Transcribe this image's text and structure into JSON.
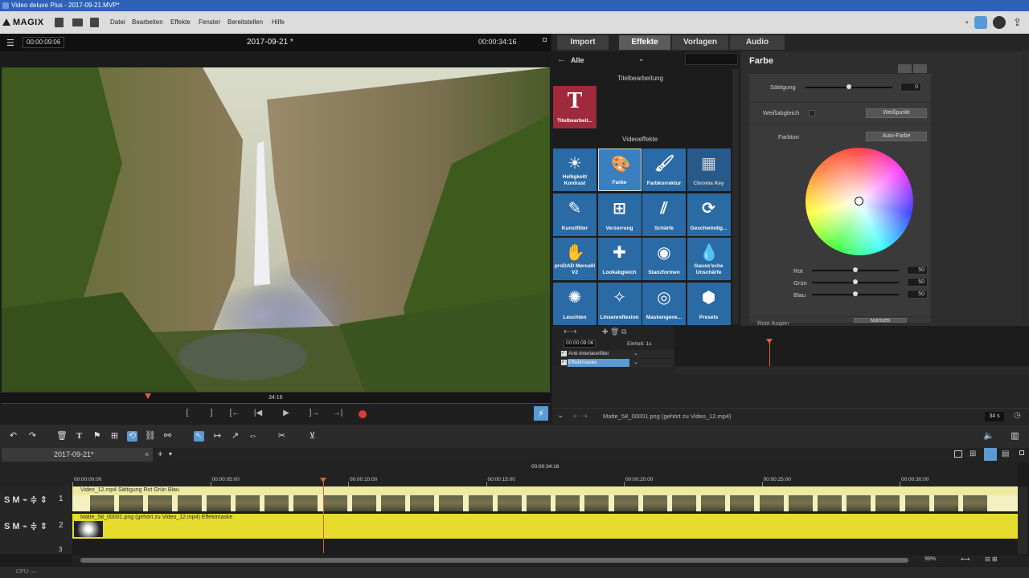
{
  "window": {
    "title": "Video deluxe Plus - 2017-09-21.MVP*"
  },
  "menu": {
    "logo": "MAGIX",
    "items": [
      "Datei",
      "Bearbeiten",
      "Effekte",
      "Fenster",
      "Bereitstellen",
      "Hilfe"
    ]
  },
  "preview": {
    "timecode_left": "00:00:09:06",
    "title": "2017-09-21 *",
    "timecode_right": "00:00:34:16",
    "scrub_label": "34:16",
    "controls": [
      "[",
      "]",
      "[←",
      "|◀",
      "▶",
      "]→",
      "→|"
    ]
  },
  "tabs": [
    "Import",
    "Effekte",
    "Vorlagen",
    "Audio"
  ],
  "fx": {
    "category": "Alle",
    "section1": "Titelbearbeitung",
    "title_tile": "Titelbearbeit...",
    "section2": "Videoeffekte",
    "tiles": [
      {
        "label": "Helligkeit/ Kontrast",
        "icon": "sun-icon"
      },
      {
        "label": "Farbe",
        "icon": "palette-icon"
      },
      {
        "label": "Farbkorrektur",
        "icon": "palette-brush-icon"
      },
      {
        "label": "Chroma Key",
        "icon": "chroma-key-icon"
      },
      {
        "label": "Kunstfilter",
        "icon": "art-filter-icon"
      },
      {
        "label": "Verzerrung",
        "icon": "grid-distort-icon"
      },
      {
        "label": "Schärfe",
        "icon": "sharpness-icon"
      },
      {
        "label": "Geschwindig...",
        "icon": "speed-icon"
      },
      {
        "label": "proDAD Mercalli V2",
        "icon": "hand-icon"
      },
      {
        "label": "Lookabgleich",
        "icon": "look-match-icon"
      },
      {
        "label": "Stanzformen",
        "icon": "stencil-icon"
      },
      {
        "label": "Gauss'sche Unschärfe",
        "icon": "blur-drop-icon"
      },
      {
        "label": "Leuchten",
        "icon": "glow-icon"
      },
      {
        "label": "Linsenreflexion",
        "icon": "lens-flare-icon"
      },
      {
        "label": "Maskengene...",
        "icon": "mask-icon"
      },
      {
        "label": "Presets",
        "icon": "hexagon-icon"
      }
    ]
  },
  "farbe": {
    "title": "Farbe",
    "saettigung_label": "Sättigung",
    "saettigung_value": "0",
    "saettigung_level": 0.5,
    "weissabgleich_label": "Weißabgleich",
    "weisspunkt_btn": "Weißpunkt",
    "farbton_label": "Farbton",
    "autofarbe_btn": "Auto-Farbe",
    "rgb": [
      {
        "label": "Rot",
        "value": "50",
        "level": 0.5
      },
      {
        "label": "Grün",
        "value": "50",
        "level": 0.5
      },
      {
        "label": "Blau",
        "value": "50",
        "level": 0.5
      }
    ],
    "rote_augen_label": "Rote Augen",
    "manuell_btn": "Manuell"
  },
  "keyframe": {
    "timecode": "00:00:09:06",
    "einheit": "Einheit: 1s",
    "rows": [
      "Anti-Interlacefilter",
      "Effektmaske"
    ]
  },
  "info_bar": {
    "text": "Matte_58_00001.png (gehört zu Video_12.mp4)",
    "duration": "34 s"
  },
  "timeline": {
    "tab": "2017-09-21*",
    "ruler_top": "00:00:34:16",
    "ticks": [
      "00:00:00:00",
      "00:00:05:00",
      "00:00:10:00",
      "00:00:15:00",
      "00:00:20:00",
      "00:00:25:00",
      "00:00:30:00"
    ],
    "track1_label": "Video_12.mp4  Sättigung  Rot  Grün  Blau",
    "track2_label": "Matte_58_00001.png (gehört zu Video_12.mp4) Effektmaske",
    "track_numbers": [
      "1",
      "2",
      "3"
    ],
    "zoom": "99%"
  },
  "status": {
    "cpu": "CPU: —"
  },
  "colors": {
    "accent": "#2a6aa5",
    "title_tile": "#9e2a3c",
    "clip_yellow": "#e6dc2e",
    "playhead": "#e0603a"
  }
}
